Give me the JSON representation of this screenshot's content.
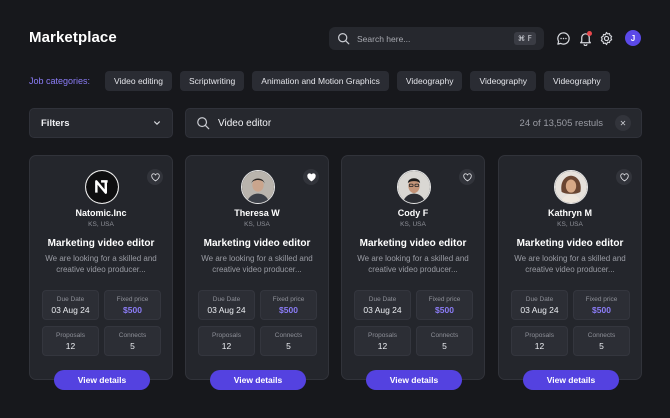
{
  "header": {
    "title": "Marketplace",
    "search_placeholder": "Search here...",
    "shortcut": "⌘ F",
    "user_initial": "J",
    "accent": "#5442e0"
  },
  "categories": {
    "label": "Job categories:",
    "items": [
      "Video editing",
      "Scriptwriting",
      "Animation and Motion Graphics",
      "Videography",
      "Videography",
      "Videography"
    ]
  },
  "filters": {
    "label": "Filters"
  },
  "search": {
    "value": "Video editor",
    "results": "24 of 13,505 restuls",
    "clear_icon": "close-icon"
  },
  "cards": [
    {
      "name": "Natomic.Inc",
      "location": "KS, USA",
      "title": "Marketing video editor",
      "description": "We are looking for a skilled and creative video producer...",
      "due_label": "Due Date",
      "due": "03 Aug 24",
      "price_label": "Fixed price",
      "price": "$500",
      "proposals_label": "Proposals",
      "proposals": "12",
      "connects_label": "Connects",
      "connects": "5",
      "button": "View details",
      "favorited": false,
      "avatar": "company-logo"
    },
    {
      "name": "Theresa W",
      "location": "KS, USA",
      "title": "Marketing video editor",
      "description": "We are looking for a skilled and creative video producer...",
      "due_label": "Due Date",
      "due": "03 Aug 24",
      "price_label": "Fixed price",
      "price": "$500",
      "proposals_label": "Proposals",
      "proposals": "12",
      "connects_label": "Connects",
      "connects": "5",
      "button": "View details",
      "favorited": true,
      "avatar": "person-photo"
    },
    {
      "name": "Cody F",
      "location": "KS, USA",
      "title": "Marketing video editor",
      "description": "We are looking for a skilled and creative video producer...",
      "due_label": "Due Date",
      "due": "03 Aug 24",
      "price_label": "Fixed price",
      "price": "$500",
      "proposals_label": "Proposals",
      "proposals": "12",
      "connects_label": "Connects",
      "connects": "5",
      "button": "View details",
      "favorited": false,
      "avatar": "person-photo"
    },
    {
      "name": "Kathryn M",
      "location": "KS, USA",
      "title": "Marketing video editor",
      "description": "We are looking for a skilled and creative video producer...",
      "due_label": "Due Date",
      "due": "03 Aug 24",
      "price_label": "Fixed price",
      "price": "$500",
      "proposals_label": "Proposals",
      "proposals": "12",
      "connects_label": "Connects",
      "connects": "5",
      "button": "View details",
      "favorited": false,
      "avatar": "person-photo"
    }
  ]
}
